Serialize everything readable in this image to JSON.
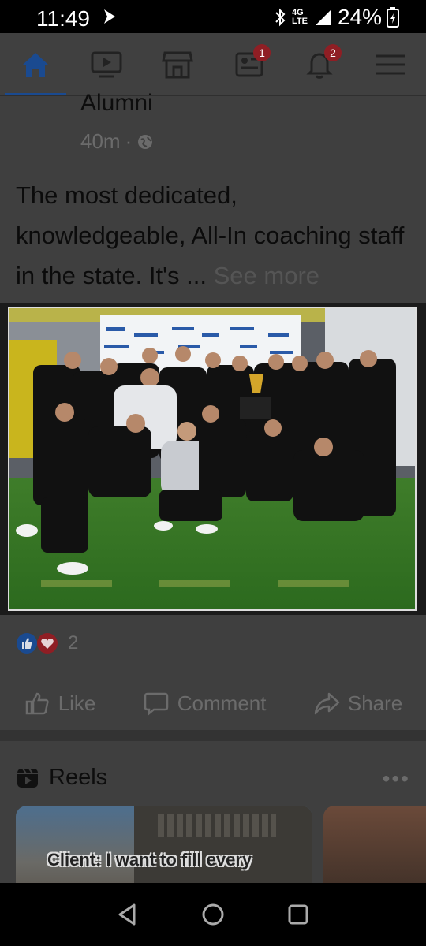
{
  "status_bar": {
    "time": "11:49",
    "network": "4G LTE",
    "battery": "24%",
    "icons": [
      "navigation-arrow-icon",
      "bluetooth-icon",
      "signal-icon",
      "battery-icon"
    ]
  },
  "topnav": {
    "items": [
      {
        "name": "home",
        "icon": "home-icon",
        "active": true
      },
      {
        "name": "watch",
        "icon": "video-icon"
      },
      {
        "name": "marketplace",
        "icon": "store-icon"
      },
      {
        "name": "news-feed",
        "icon": "feed-icon",
        "badge": "1"
      },
      {
        "name": "notifications",
        "icon": "bell-icon",
        "badge": "2"
      },
      {
        "name": "menu",
        "icon": "hamburger-icon"
      }
    ]
  },
  "post": {
    "author": "Alumni",
    "time": "40m",
    "audience_icon": "globe-icon",
    "text": "The most dedicated, knowledgeable, All-In coaching staff in the state.  It's ...",
    "see_more": "See more",
    "reaction_count": "2",
    "reaction_icons": [
      "like-icon",
      "love-icon"
    ],
    "actions": {
      "like": "Like",
      "comment": "Comment",
      "share": "Share"
    }
  },
  "reels": {
    "title": "Reels",
    "more": "•••",
    "card_caption": "Client: I want to fill every"
  },
  "colors": {
    "accent": "#1a4a90",
    "badge": "#8f1e24",
    "text_dim": "#6b6b6b"
  }
}
